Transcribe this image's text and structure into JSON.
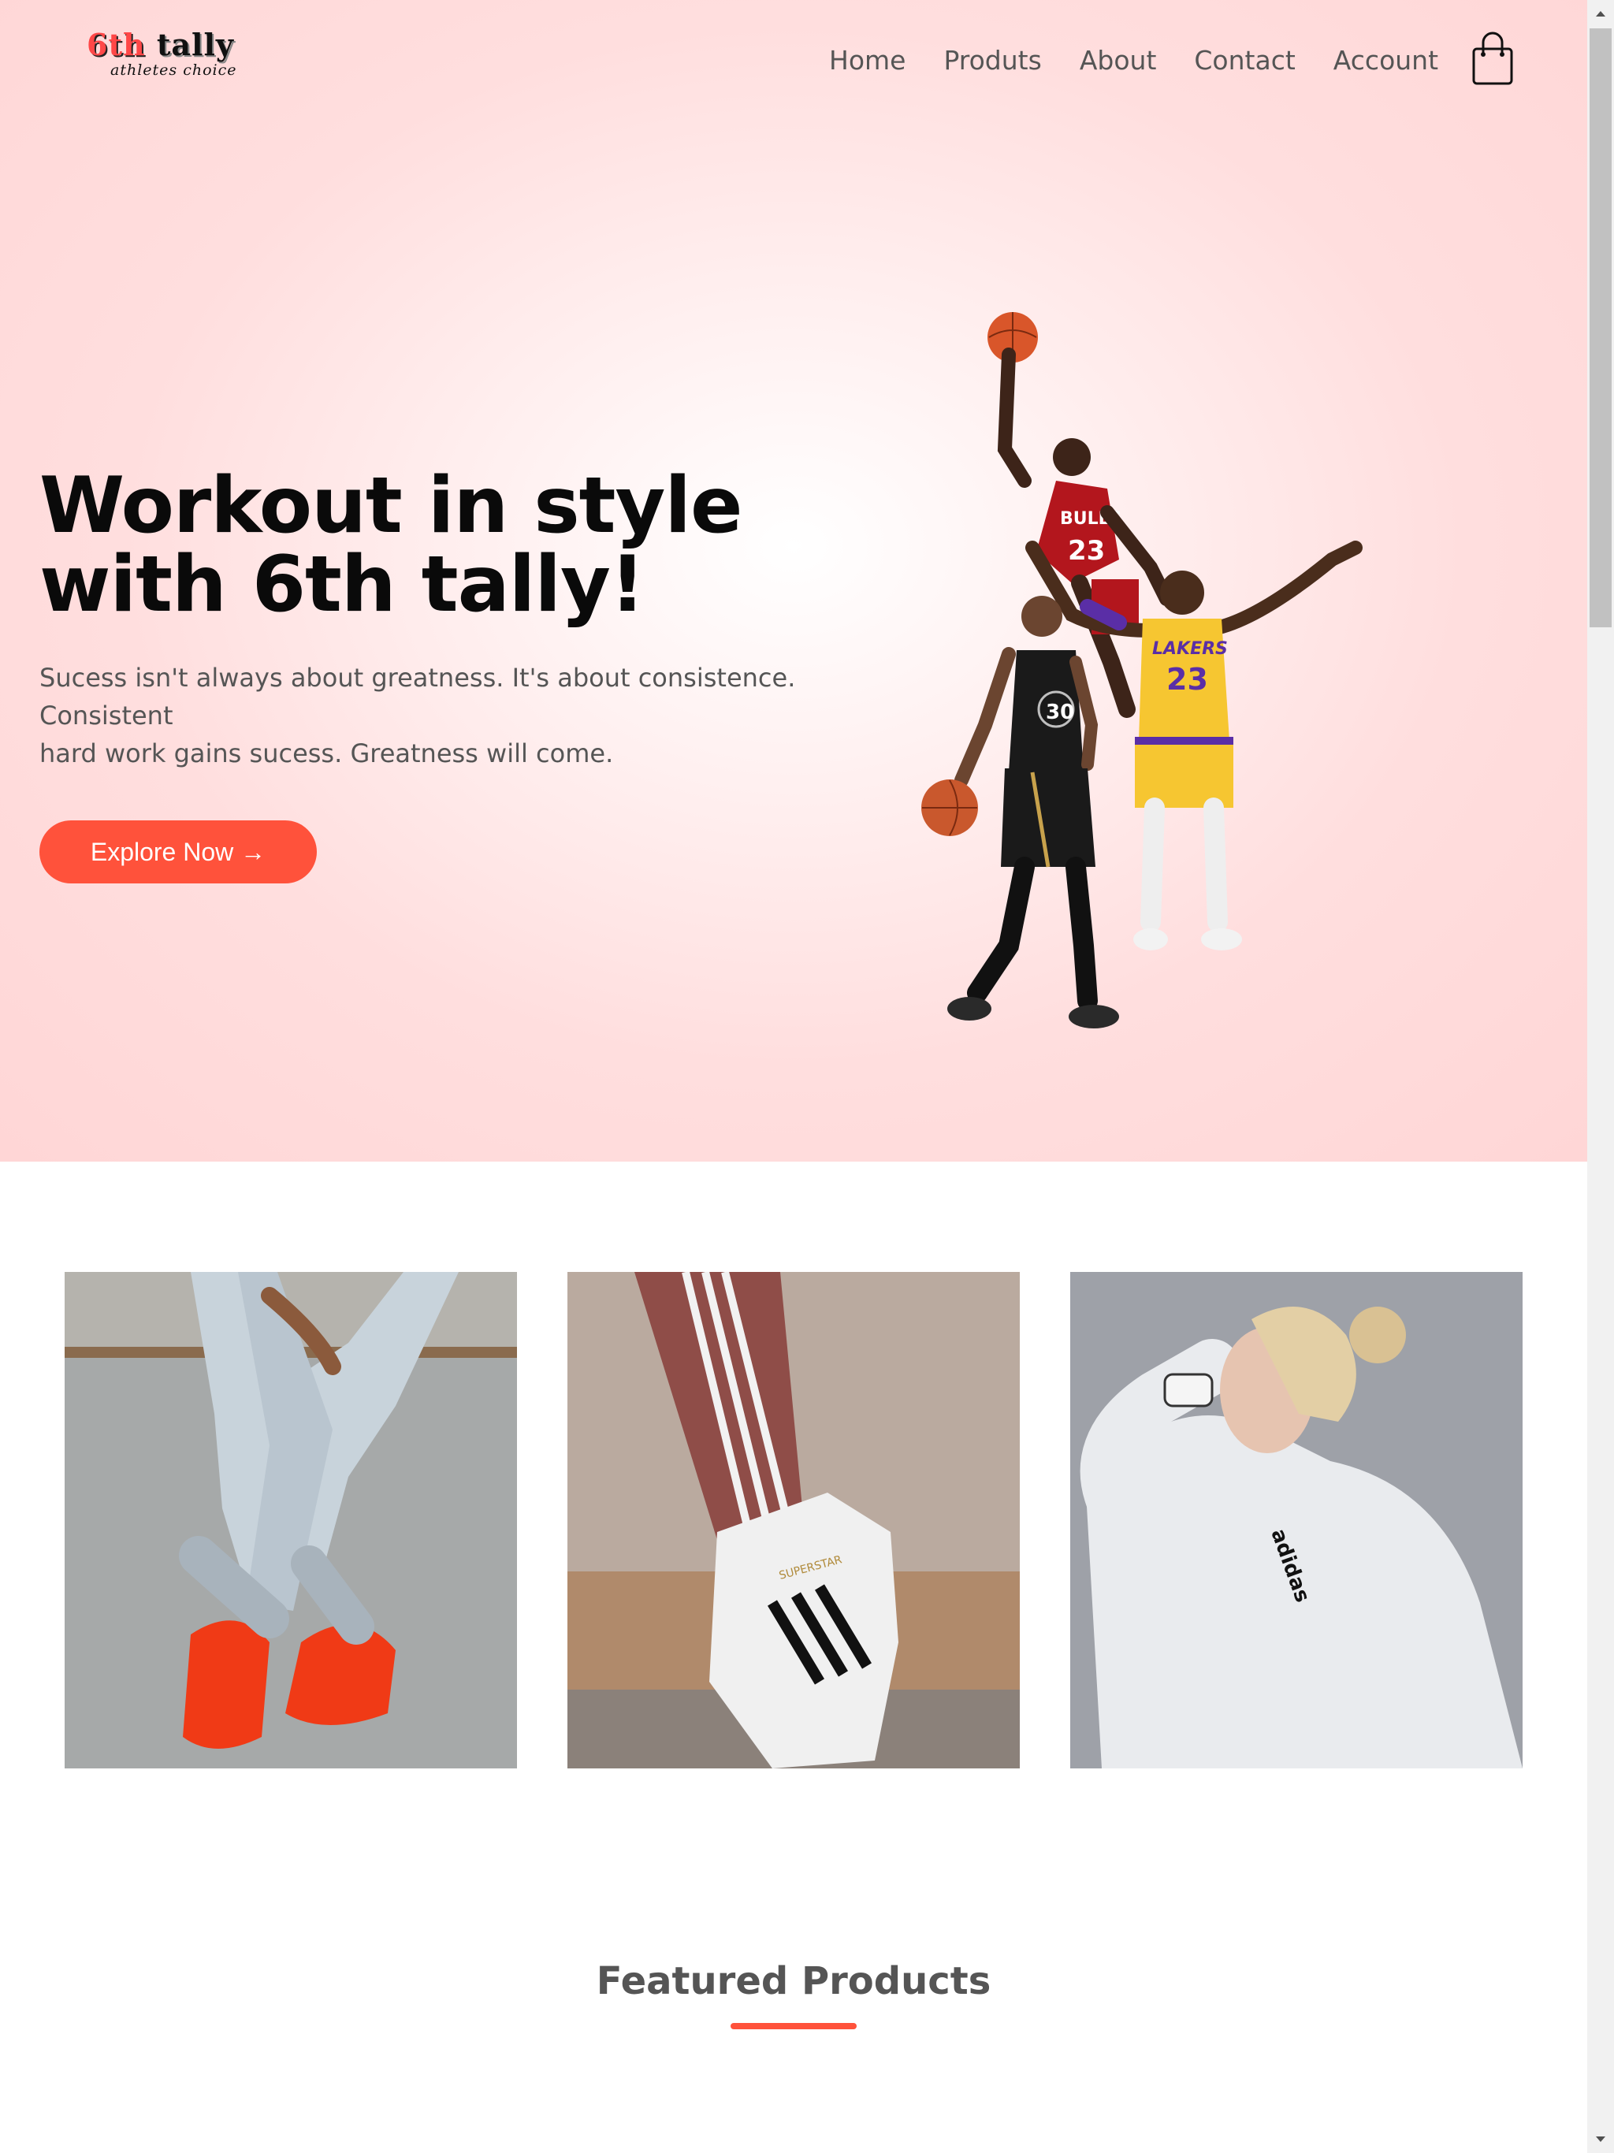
{
  "brand": {
    "logo_main_red": "6th",
    "logo_main_dark": "tally",
    "logo_sub": "athletes choice"
  },
  "nav": {
    "items": [
      "Home",
      "Produts",
      "About",
      "Contact",
      "Account"
    ]
  },
  "hero": {
    "headline_line1": "Workout in style",
    "headline_line2": "with 6th tally!",
    "subtext_line1": "Sucess isn't always about greatness. It's about consistence.",
    "subtext_line2": "Consistent",
    "subtext_line3": "hard work gains sucess. Greatness will come.",
    "cta_label": "Explore Now →"
  },
  "players": {
    "jersey_back_team": "BULLS",
    "jersey_back_number": "23",
    "jersey_middle_team": "LAKERS",
    "jersey_middle_number": "23",
    "jersey_front_number": "30"
  },
  "categories": [
    {
      "name": "red-sneakers-jeans"
    },
    {
      "name": "striped-track-pants-sneaker",
      "shoe_text": "SUPERSTAR"
    },
    {
      "name": "woman-white-hoodie",
      "hoodie_text": "adidas"
    }
  ],
  "featured": {
    "title": "Featured Products"
  },
  "colors": {
    "accent": "#ff523b",
    "hero_bg": "#ffd6d6",
    "heading": "#0a0a0a",
    "body_text": "#555555"
  }
}
